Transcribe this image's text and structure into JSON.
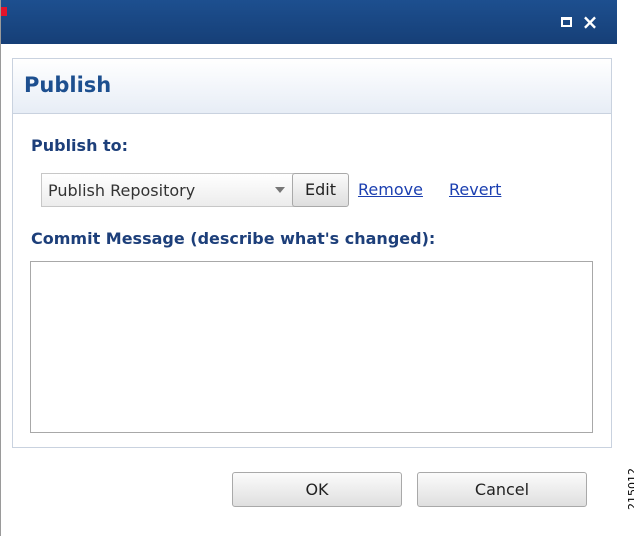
{
  "window": {
    "maximize_icon": "maximize-icon",
    "close_icon": "close-icon",
    "close_glyph": "×"
  },
  "panel": {
    "title": "Publish"
  },
  "form": {
    "publish_to_label": "Publish to:",
    "repository_select_value": "Publish Repository",
    "edit_label": "Edit",
    "remove_label": "Remove",
    "revert_label": "Revert",
    "commit_label": "Commit Message (describe what's changed):",
    "commit_value": ""
  },
  "footer": {
    "ok_label": "OK",
    "cancel_label": "Cancel"
  },
  "side_id": "215012",
  "colors": {
    "titlebar": "#1d4f8f",
    "title_text": "#1d4f8f",
    "label_text": "#1d3f7a",
    "link": "#1b3fb0",
    "marker": "#e2132b"
  }
}
